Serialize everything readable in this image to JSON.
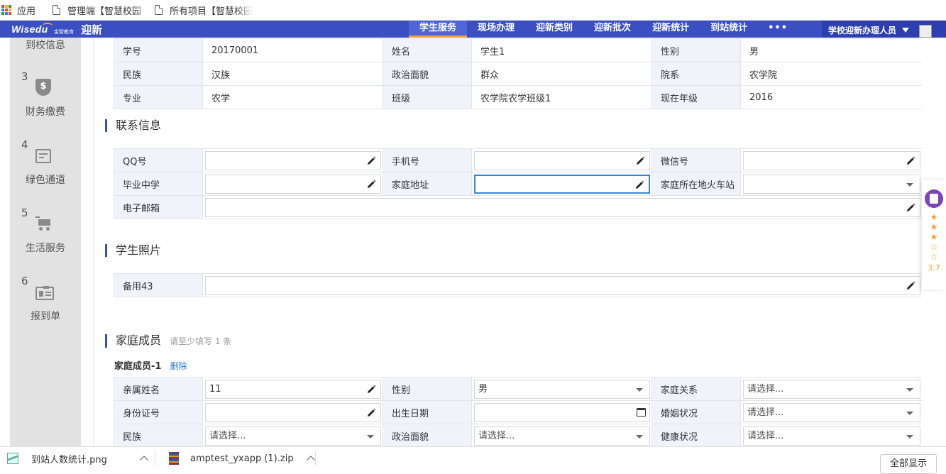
{
  "bookmarks": {
    "apps_label": "应用",
    "items": [
      {
        "label": "管理端【智慧校园云"
      },
      {
        "label": "所有项目【智慧校园"
      }
    ]
  },
  "header": {
    "logo_text": "Wisedu",
    "logo_sub": "金智教育",
    "app_title": "迎新",
    "tabs": [
      {
        "label": "学生服务",
        "active": true
      },
      {
        "label": "现场办理"
      },
      {
        "label": "迎新类别"
      },
      {
        "label": "迎新批次"
      },
      {
        "label": "迎新统计"
      },
      {
        "label": "到站统计"
      }
    ],
    "more_label": "•••",
    "user_role": "学校迎新办理人员"
  },
  "sidebar": {
    "partial_label": "到校信息",
    "steps": [
      {
        "num": "3",
        "label": "财务缴费",
        "icon": "finance-shield-icon",
        "icon_glyph": "$"
      },
      {
        "num": "4",
        "label": "绿色通道",
        "icon": "calendar-icon"
      },
      {
        "num": "5",
        "label": "生活服务",
        "icon": "cart-icon"
      },
      {
        "num": "6",
        "label": "报到单",
        "icon": "id-card-icon"
      }
    ]
  },
  "basic_info": {
    "rows": [
      [
        {
          "label": "学号",
          "value": "20170001"
        },
        {
          "label": "姓名",
          "value": "学生1"
        },
        {
          "label": "性别",
          "value": "男"
        }
      ],
      [
        {
          "label": "民族",
          "value": "汉族"
        },
        {
          "label": "政治面貌",
          "value": "群众"
        },
        {
          "label": "院系",
          "value": "农学院"
        }
      ],
      [
        {
          "label": "专业",
          "value": "农学"
        },
        {
          "label": "班级",
          "value": "农学院农学班级1"
        },
        {
          "label": "现在年级",
          "value": "2016"
        }
      ]
    ]
  },
  "contact": {
    "title": "联系信息",
    "qq_label": "QQ号",
    "phone_label": "手机号",
    "wechat_label": "微信号",
    "school_label": "毕业中学",
    "address_label": "家庭地址",
    "station_label": "家庭所在地火车站",
    "email_label": "电子邮箱"
  },
  "photo": {
    "title": "学生照片",
    "spare_label": "备用43"
  },
  "family": {
    "title": "家庭成员",
    "hint": "请至少填写 1 条",
    "member_title": "家庭成员-1",
    "delete_label": "删除",
    "name_label": "亲属姓名",
    "name_value": "11",
    "gender_label": "性别",
    "gender_value": "男",
    "relation_label": "家庭关系",
    "relation_placeholder": "请选择...",
    "id_label": "身份证号",
    "birth_label": "出生日期",
    "marital_label": "婚姻状况",
    "marital_placeholder": "请选择...",
    "nation_label": "民族",
    "nation_placeholder": "请选择...",
    "political_label": "政治面貌",
    "political_placeholder": "请选择...",
    "health_label": "健康状况",
    "health_placeholder": "请选择..."
  },
  "rating": {
    "stars_filled": 3,
    "stars_total": 5,
    "value": "3.7"
  },
  "downloads": {
    "items": [
      {
        "name": "到站人数统计.png",
        "icon": "image-file-icon"
      },
      {
        "name": "amptest_yxapp (1).zip",
        "icon": "zip-file-icon"
      }
    ],
    "show_all": "全部显示"
  },
  "colors": {
    "nav_bg": "#3b4fc3",
    "active_tab_underline": "#f0a030",
    "section_bar": "#3b4fc3",
    "link": "#2a7ae2",
    "focus": "#3a86d6"
  }
}
